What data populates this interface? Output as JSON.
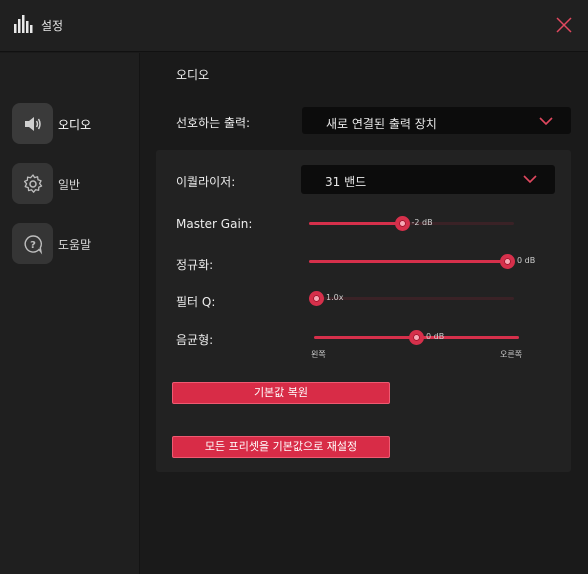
{
  "window": {
    "title": "설정",
    "app_icon": "equalizer-bars-icon",
    "close_icon": "close-icon"
  },
  "sidebar": {
    "items": [
      {
        "label": "오디오",
        "icon": "speaker-icon",
        "active": true
      },
      {
        "label": "일반",
        "icon": "gear-icon",
        "active": false
      },
      {
        "label": "도움말",
        "icon": "help-icon",
        "active": false
      }
    ]
  },
  "main": {
    "section_title": "오디오",
    "output": {
      "label": "선호하는 출력:",
      "value": "새로 연결된 출력 장치"
    },
    "equalizer": {
      "label": "이퀄라이저:",
      "value": "31 밴드"
    },
    "sliders": {
      "master_gain": {
        "label": "Master Gain:",
        "value_text": "-2 dB",
        "level": 0.45
      },
      "normalize": {
        "label": "정규화:",
        "value_text": "0 dB",
        "level": 1.0
      },
      "filter_q": {
        "label": "필터 Q:",
        "value_text": "1.0x",
        "level": 0.0
      },
      "balance": {
        "label": "음균형:",
        "value_text": "0 dB",
        "level": 0.5,
        "left_label": "왼쪽",
        "right_label": "오른쪽"
      }
    },
    "reset_button": "기본값 복원",
    "reset_all_presets_button": "모든 프리셋을 기본값으로 재설정"
  },
  "colors": {
    "accent": "#d82c47",
    "background": "#1a1a1a",
    "panel": "#222222",
    "dropdown": "#0c0c0c"
  }
}
